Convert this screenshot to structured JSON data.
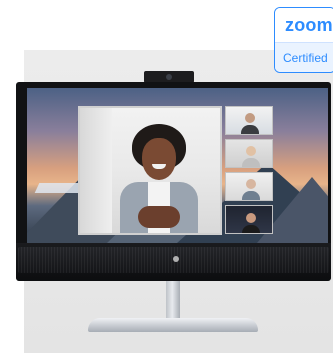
{
  "badge": {
    "brand_text": "zoom",
    "subtitle": "Certified",
    "accent_color": "#2d8cff"
  },
  "scene": {
    "device": "monitor",
    "content": "video-call"
  }
}
